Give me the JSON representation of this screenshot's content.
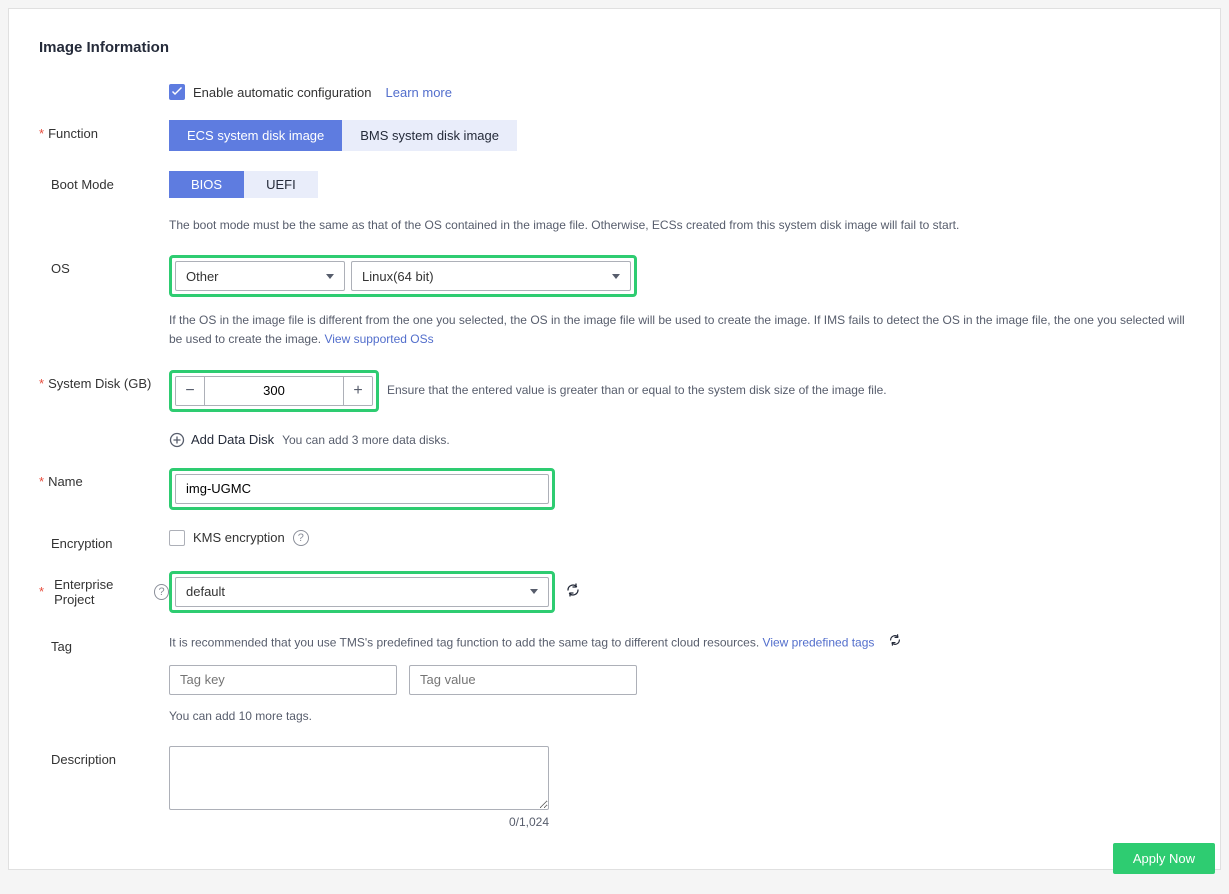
{
  "section_title": "Image Information",
  "auto_config": {
    "label": "Enable automatic configuration",
    "learn_more": "Learn more"
  },
  "function": {
    "label": "Function",
    "options": [
      "ECS system disk image",
      "BMS system disk image"
    ],
    "selected": 0
  },
  "boot_mode": {
    "label": "Boot Mode",
    "options": [
      "BIOS",
      "UEFI"
    ],
    "selected": 0,
    "help": "The boot mode must be the same as that of the OS contained in the image file. Otherwise, ECSs created from this system disk image will fail to start."
  },
  "os": {
    "label": "OS",
    "type": "Other",
    "arch": "Linux(64 bit)",
    "help": "If the OS in the image file is different from the one you selected, the OS in the image file will be used to create the image. If IMS fails to detect the OS in the image file, the one you selected will be used to create the image.",
    "view_link": "View supported OSs"
  },
  "system_disk": {
    "label": "System Disk (GB)",
    "value": "300",
    "help": "Ensure that the entered value is greater than or equal to the system disk size of the image file.",
    "add_label": "Add Data Disk",
    "add_help": "You can add 3 more data disks."
  },
  "name": {
    "label": "Name",
    "value": "img-UGMC"
  },
  "encryption": {
    "label": "Encryption",
    "kms_label": "KMS encryption"
  },
  "enterprise_project": {
    "label": "Enterprise Project",
    "value": "default"
  },
  "tag": {
    "label": "Tag",
    "help": "It is recommended that you use TMS's predefined tag function to add the same tag to different cloud resources.",
    "view_link": "View predefined tags",
    "key_placeholder": "Tag key",
    "value_placeholder": "Tag value",
    "add_help": "You can add 10 more tags."
  },
  "description": {
    "label": "Description",
    "count": "0/1,024"
  },
  "apply_label": "Apply Now"
}
